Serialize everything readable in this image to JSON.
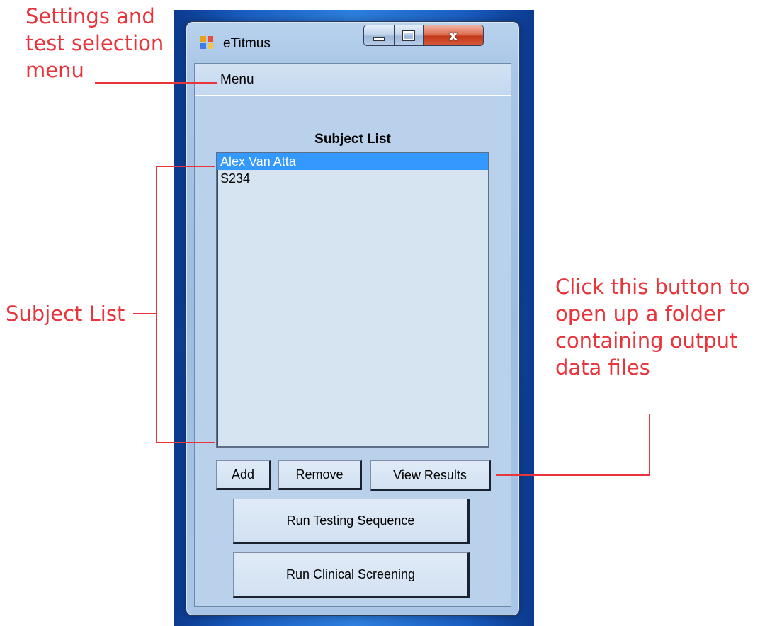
{
  "window": {
    "title": "eTitmus",
    "close_glyph": "x",
    "icon": "app-icon"
  },
  "menubar": {
    "menu_label": "Menu"
  },
  "subject_list": {
    "title": "Subject List",
    "items": [
      "Alex Van Atta",
      "S234"
    ],
    "selected_index": 0
  },
  "buttons": {
    "add": "Add",
    "remove": "Remove",
    "view_results": "View Results",
    "run_testing_sequence": "Run Testing Sequence",
    "run_clinical_screening": "Run Clinical Screening"
  },
  "annotations": {
    "menu_note": [
      "Settings and",
      "test selection",
      "menu"
    ],
    "subject_list_note": "Subject List",
    "view_results_note": [
      "Click this button to",
      "open up a folder",
      "containing output",
      "data files"
    ]
  },
  "colors": {
    "annotation": "#e8353b",
    "selection": "#3399ff",
    "client_bg": "#b9d1ea"
  }
}
